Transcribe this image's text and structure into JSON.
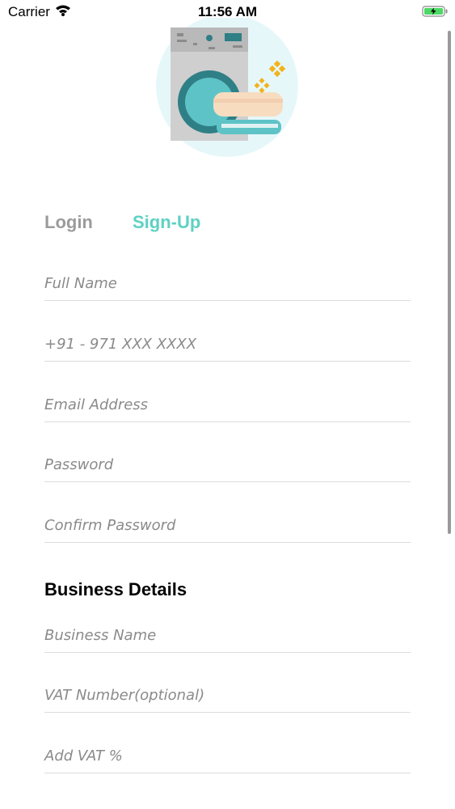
{
  "status_bar": {
    "carrier": "Carrier",
    "time": "11:56 AM"
  },
  "logo": {
    "icon": "washing-machine-icon"
  },
  "tabs": {
    "login": "Login",
    "signup": "Sign-Up",
    "active": "signup"
  },
  "fields": {
    "full_name": "Full Name",
    "phone": "+91 - 971 XXX XXXX",
    "email": "Email Address",
    "password": "Password",
    "confirm_password": "Confirm Password",
    "business_name": "Business Name",
    "vat_number": "VAT Number(optional)",
    "vat_percent": "Add VAT %"
  },
  "business_section": {
    "title": "Business Details"
  },
  "colors": {
    "accent": "#5ed1c3",
    "inactive_tab": "#9b9b9b",
    "placeholder": "#8a8a8a",
    "divider": "#dcdcdc"
  }
}
